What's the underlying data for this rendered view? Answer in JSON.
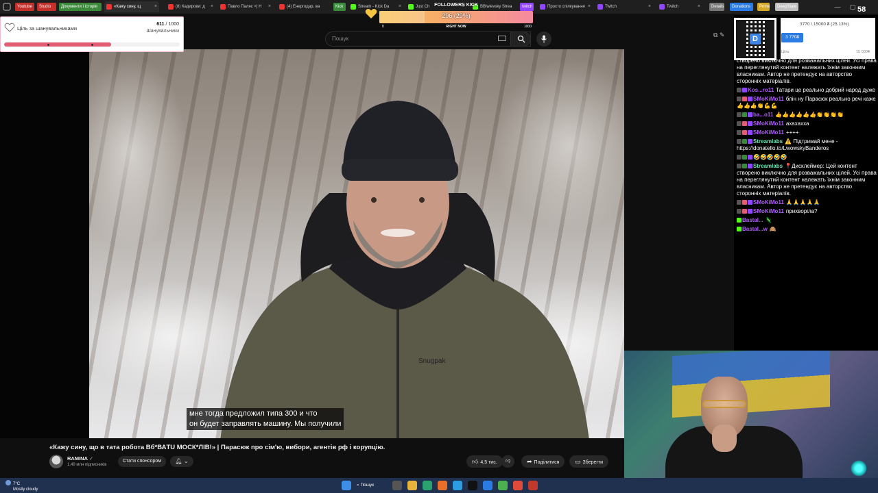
{
  "browser": {
    "bookmarks": [
      {
        "label": "Youtube",
        "color": "#c4302b"
      },
      {
        "label": "Studio",
        "color": "#c4302b"
      },
      {
        "label": "Документи і історія",
        "color": "#3b8a3b"
      }
    ],
    "tabs": [
      {
        "label": "«Кажу сину, щ",
        "color": "#e33",
        "active": true
      },
      {
        "label": "(8) Кадирови: д",
        "color": "#e33"
      },
      {
        "label": "Павло Паляс ×| Н",
        "color": "#e33"
      },
      {
        "label": "(4) Енергодар, ва",
        "color": "#e33"
      },
      {
        "label": "Stream - Kick Da",
        "color": "#53fc18"
      },
      {
        "label": "Just Ch",
        "color": "#53fc18"
      },
      {
        "label": "BBlwievsky Strea",
        "color": "#53fc18"
      },
      {
        "label": "Просто спілкування",
        "color": "#9146ff"
      },
      {
        "label": "Twitch",
        "color": "#9146ff"
      },
      {
        "label": "Twitch",
        "color": "#9146ff"
      }
    ],
    "right_bookmarks": [
      {
        "label": "Kick",
        "color": "#3b8a3b"
      },
      {
        "label": "twitch",
        "color": "#9146ff"
      },
      {
        "label": "Details",
        "color": "#777"
      },
      {
        "label": "Donations",
        "color": "#2a7be4"
      },
      {
        "label": "Prime",
        "color": "#d4a82b"
      },
      {
        "label": "DeepState",
        "color": "#c0c0c0"
      }
    ]
  },
  "youtube": {
    "search_placeholder": "Пошук",
    "subtitle_line1": "мне тогда предложил типа 300 и что",
    "subtitle_line2": "он будет заправлять машину. Мы получили",
    "video_title": "«Кажу сину, що в тата робота Вб*ВАTU МОСК*ЛІВ!» | Парасюк про сім'ю, вибори, агентів рф і корупцію.",
    "channel_name": "RAMINA",
    "channel_subs": "1,49 млн підписників",
    "sponsor_label": "Стати спонсором",
    "likes": "4,5 тис.",
    "share_label": "Поділитися",
    "save_label": "Зберегти"
  },
  "follower_goal": {
    "title": "Ціль за шанувальниками",
    "current": "611",
    "target": "/ 1000",
    "label": "Шанувальники",
    "progress": 0.611
  },
  "kick_goal": {
    "title": "FOLLOWERS KICK",
    "value_text": "296 (29%)",
    "progress": 0.296,
    "min": "0",
    "mid": "RIGHT NOW",
    "max": "1000"
  },
  "donation_goal": {
    "line": "3770 / 15000 ₴ (25.13%)",
    "button": "3 770₴",
    "label": "Ціль",
    "max": "15 000₴",
    "qr_letter": "D"
  },
  "chat": [
    {
      "user": "",
      "text": "створено виключно для розважальних цілей. Усі права на переглянутий контент належать їхнім законним власникам. Автор не претендує на авторство сторонніх матеріалів.",
      "color": "#ffffff",
      "badges": []
    },
    {
      "user": "Kos...ro11",
      "text": "Татари це реально добрий народ дуже",
      "color": "#b35cff",
      "badges": [
        "#555",
        "#9146ff"
      ]
    },
    {
      "user": "SMoKiMo11",
      "text": "блін ну Парасюк реально речі каже 👍👍👍👏💪💪",
      "color": "#b35cff",
      "badges": [
        "#555",
        "#e05d74",
        "#9146ff"
      ]
    },
    {
      "user": "ba...o11",
      "text": "👍👍👍👍👍👍👏👏👏👏",
      "color": "#b35cff",
      "badges": [
        "#555",
        "#3b8a3b",
        "#9146ff"
      ]
    },
    {
      "user": "SMoKiMo11",
      "text": "ахахахха",
      "color": "#b35cff",
      "badges": [
        "#555",
        "#e05d74",
        "#9146ff"
      ]
    },
    {
      "user": "SMoKiMo11",
      "text": "++++",
      "color": "#b35cff",
      "badges": [
        "#555",
        "#e05d74",
        "#9146ff"
      ]
    },
    {
      "user": "Streamlabs",
      "text": "⚠️ Підтримай мене - https://donatello.to/LwowskyBanderos",
      "color": "#6fe3b5",
      "badges": [
        "#555",
        "#3b8a3b",
        "#9146ff"
      ]
    },
    {
      "user": "",
      "text": "🤣🤣🤣🤣🤣",
      "color": "#b35cff",
      "badges": [
        "#555",
        "#3b8a3b",
        "#9146ff"
      ]
    },
    {
      "user": "Streamlabs",
      "text": "📍Дисклеймер: Цей контент створено виключно для розважальних цілей. Усі права на переглянутий контент належать їхнім законним власникам. Автор не претендує на авторство сторонніх матеріалів.",
      "color": "#6fe3b5",
      "badges": [
        "#555",
        "#3b8a3b",
        "#9146ff"
      ]
    },
    {
      "user": "SMoKiMo11",
      "text": "🙏🙏🙏🙏🙏",
      "color": "#b35cff",
      "badges": [
        "#555",
        "#e05d74",
        "#9146ff"
      ]
    },
    {
      "user": "SMoKiMo11",
      "text": "прихворіла?",
      "color": "#b35cff",
      "badges": [
        "#555",
        "#e05d74",
        "#9146ff"
      ]
    },
    {
      "user": "Bastal...",
      "text": "🦎",
      "color": "#b35cff",
      "badges": [
        "#53fc18"
      ]
    },
    {
      "user": "Bastal...w",
      "text": "🙈",
      "color": "#b35cff",
      "badges": [
        "#53fc18"
      ]
    }
  ],
  "taskbar": {
    "temperature": "7°C",
    "weather": "Mostly cloudy",
    "search_label": "Пошук",
    "counter": "58"
  }
}
